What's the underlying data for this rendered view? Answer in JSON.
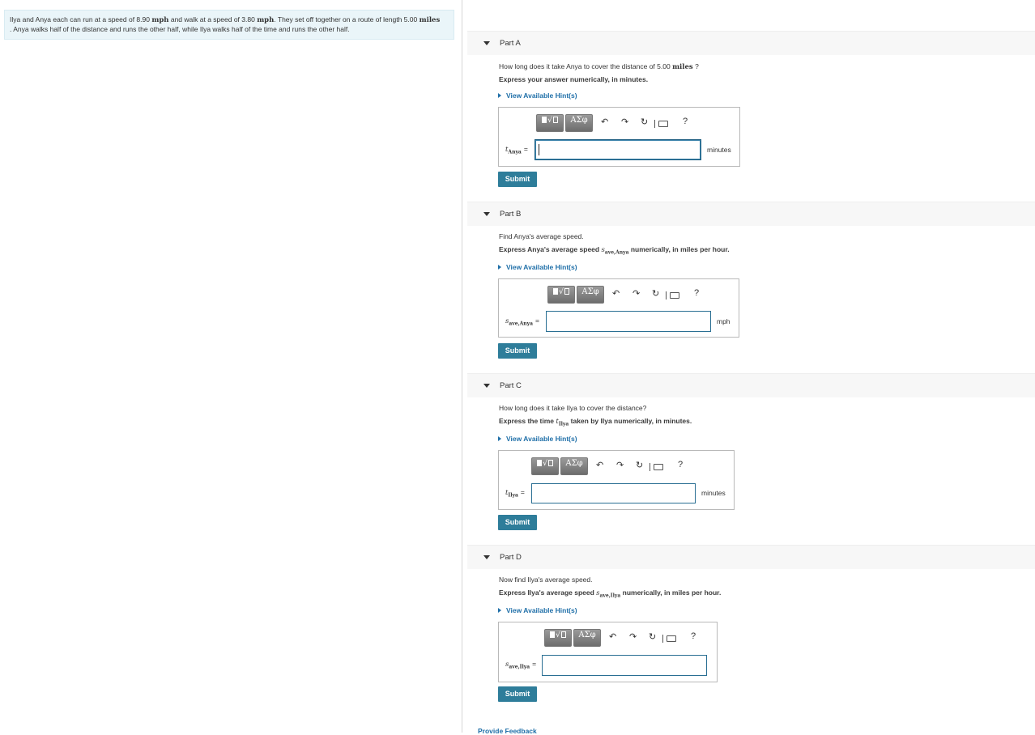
{
  "problem": {
    "text_1": "Ilya and Anya each can run at a speed of 8.90",
    "unit_1": "mph",
    "text_2": "and walk at a speed of 3.80",
    "unit_2": "mph",
    "text_3": ". They set off together on a route of length 5.00",
    "unit_3": "miles",
    "text_4": ". Anya walks half of the distance and runs the other half, while Ilya walks half of the time and runs the other half."
  },
  "parts": [
    {
      "title": "Part A",
      "question": "How long does it take Anya to cover the distance of 5.00",
      "question_unit": "miles",
      "question_end": " ?",
      "instruction": "Express your answer numerically, in minutes.",
      "hint": "View Available Hint(s)",
      "var_main": "t",
      "var_sub": "Anya",
      "unit": "minutes",
      "value": "",
      "submit": "Submit"
    },
    {
      "title": "Part B",
      "question": "Find Anya's average speed.",
      "instruction_pre": "Express Anya's average speed ",
      "instruction_sym": "s",
      "instruction_sub": "ave,Anya",
      "instruction_post": " numerically, in miles per hour.",
      "hint": "View Available Hint(s)",
      "var_main": "s",
      "var_sub": "ave,Anya",
      "unit": "mph",
      "value": "",
      "submit": "Submit"
    },
    {
      "title": "Part C",
      "question": "How long does it take Ilya to cover the distance?",
      "instruction_pre": "Express the time ",
      "instruction_sym": "t",
      "instruction_sub": "Ilya",
      "instruction_post": " taken by Ilya numerically, in minutes.",
      "hint": "View Available Hint(s)",
      "var_main": "t",
      "var_sub": "Ilya",
      "unit": "minutes",
      "value": "",
      "submit": "Submit"
    },
    {
      "title": "Part D",
      "question": "Now find Ilya's average speed.",
      "instruction_pre": "Express Ilya's average speed ",
      "instruction_sym": "s",
      "instruction_sub": "ave,Ilya",
      "instruction_post": " numerically, in miles per hour.",
      "hint": "View Available Hint(s)",
      "var_main": "s",
      "var_sub": "ave,Ilya",
      "unit": "",
      "value": "",
      "submit": "Submit"
    }
  ],
  "toolbar": {
    "templates_label": "√▢",
    "greek_label": "ΑΣφ",
    "undo": "↶",
    "redo": "↷",
    "reset": "↻",
    "help": "?"
  },
  "feedback": "Provide Feedback"
}
